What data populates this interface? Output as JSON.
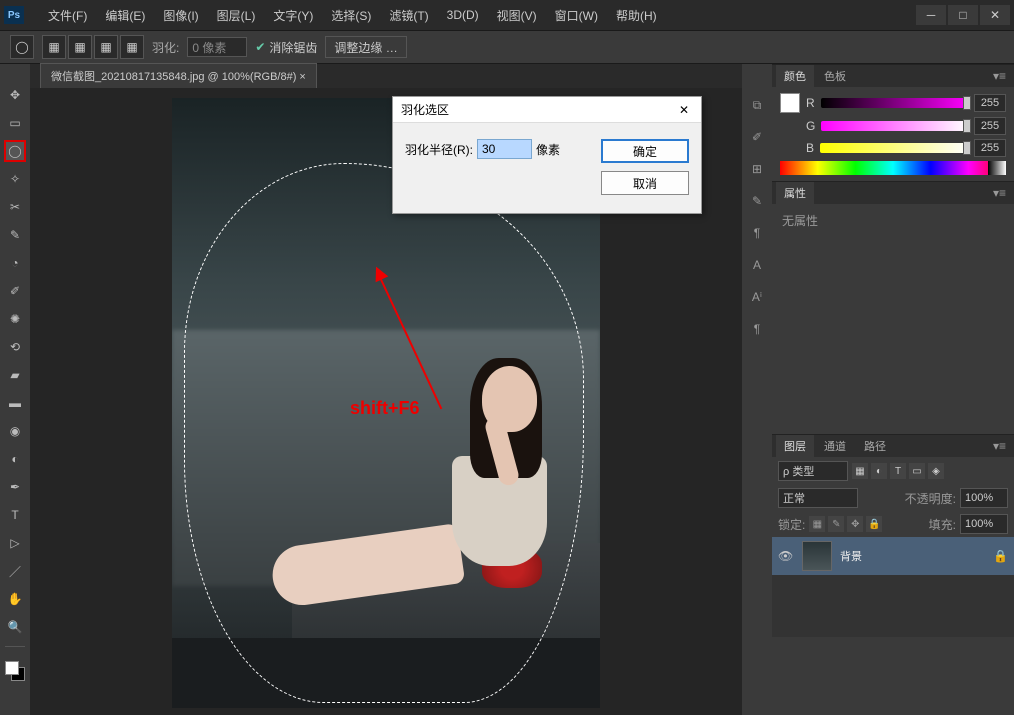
{
  "app": {
    "logo": "Ps"
  },
  "menu": {
    "file": "文件(F)",
    "edit": "编辑(E)",
    "image": "图像(I)",
    "layer": "图层(L)",
    "type": "文字(Y)",
    "select": "选择(S)",
    "filter": "滤镜(T)",
    "threeD": "3D(D)",
    "view": "视图(V)",
    "window": "窗口(W)",
    "help": "帮助(H)"
  },
  "options": {
    "feather_label": "羽化:",
    "feather_value": "0 像素",
    "antialias": "消除锯齿",
    "refine_edge": "调整边缘 …"
  },
  "doc": {
    "tab": "微信截图_20210817135848.jpg @ 100%(RGB/8#) ×"
  },
  "annotation": {
    "text": "shift+F6"
  },
  "dialog": {
    "title": "羽化选区",
    "radius_label": "羽化半径(R):",
    "radius_value": "30",
    "unit": "像素",
    "ok": "确定",
    "cancel": "取消"
  },
  "panels": {
    "color": {
      "tab_color": "颜色",
      "tab_swatches": "色板",
      "r_label": "R",
      "r_val": "255",
      "g_label": "G",
      "g_val": "255",
      "b_label": "B",
      "b_val": "255"
    },
    "properties": {
      "tab": "属性",
      "empty": "无属性"
    },
    "layers": {
      "tab_layers": "图层",
      "tab_channels": "通道",
      "tab_paths": "路径",
      "kind": "ρ 类型",
      "blend": "正常",
      "opacity_label": "不透明度:",
      "opacity_val": "100%",
      "lock_label": "锁定:",
      "fill_label": "填充:",
      "fill_val": "100%",
      "layer_bg": "背景"
    }
  }
}
